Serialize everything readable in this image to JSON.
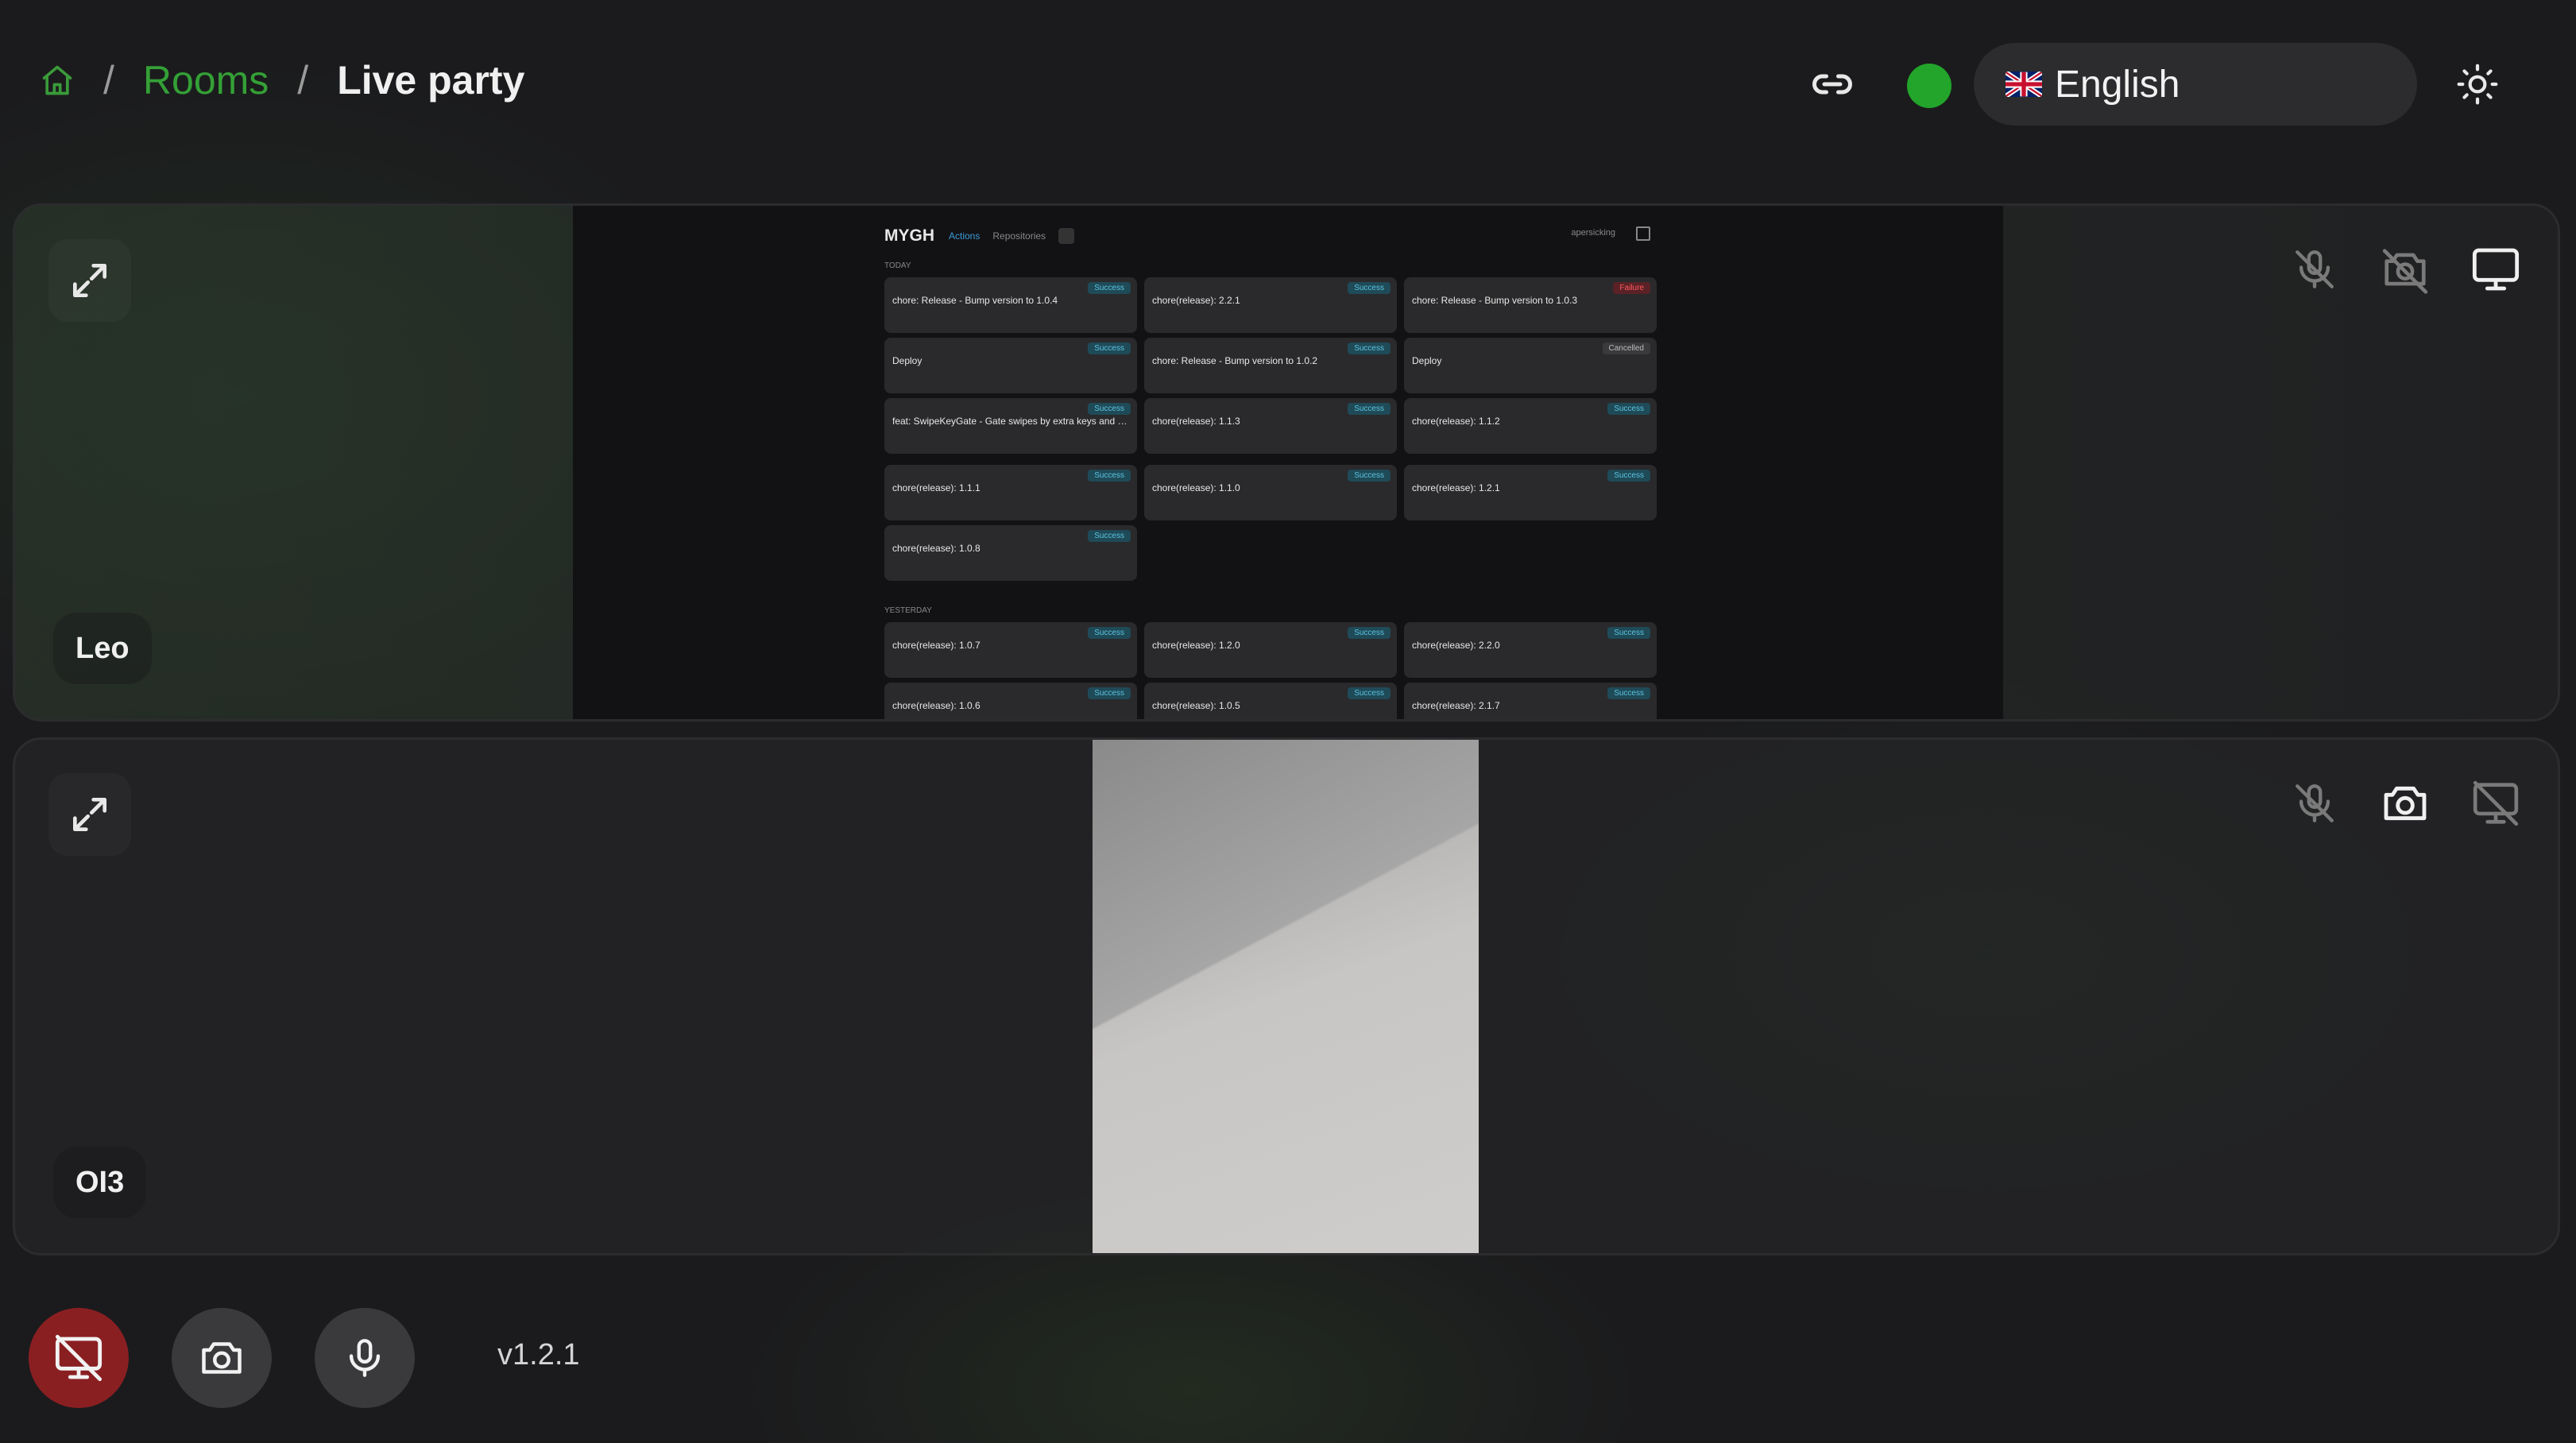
{
  "header": {
    "breadcrumb": {
      "home_icon": "home-icon",
      "separator": "/",
      "rooms": "Rooms",
      "current": "Live party"
    },
    "link_icon": "link-icon",
    "status_color": "#22a52a",
    "language": {
      "flag": "uk-flag-icon",
      "label": "English"
    },
    "theme_icon": "sun-icon"
  },
  "participants": [
    {
      "name": "Leo",
      "controls": [
        "mic-off-icon",
        "camera-off-icon",
        "screen-share-icon"
      ],
      "screen_share": {
        "app_title": "MYGH",
        "tabs": [
          "Actions",
          "Repositories"
        ],
        "user": "apersicking",
        "sections": {
          "today": "TODAY",
          "yesterday": "YESTERDAY"
        },
        "cards": [
          {
            "title": "chore: Release - Bump version to 1.0.4",
            "status": "Success"
          },
          {
            "title": "chore(release): 2.2.1",
            "status": "Success"
          },
          {
            "title": "chore: Release - Bump version to 1.0.3",
            "status": "Failure"
          },
          {
            "title": "Deploy",
            "status": "Success"
          },
          {
            "title": "chore: Release - Bump version to 1.0.2",
            "status": "Success"
          },
          {
            "title": "Deploy",
            "status": "Cancelled"
          },
          {
            "title": "feat: SwipeKeyGate - Gate swipes by extra keys and modifiers",
            "status": "Success"
          },
          {
            "title": "chore(release): 1.1.3",
            "status": "Success"
          },
          {
            "title": "chore(release): 1.1.2",
            "status": "Success"
          },
          {
            "title": "chore(release): 1.1.1",
            "status": "Success"
          },
          {
            "title": "chore(release): 1.1.0",
            "status": "Success"
          },
          {
            "title": "chore(release): 1.2.1",
            "status": "Success"
          },
          {
            "title": "chore(release): 1.0.8",
            "status": "Success"
          },
          {
            "title": "chore(release): 1.0.7",
            "status": "Success"
          },
          {
            "title": "chore(release): 1.2.0",
            "status": "Success"
          },
          {
            "title": "chore(release): 2.2.0",
            "status": "Success"
          },
          {
            "title": "chore(release): 1.0.6",
            "status": "Success"
          },
          {
            "title": "chore(release): 1.0.5",
            "status": "Success"
          },
          {
            "title": "chore(release): 2.1.7",
            "status": "Success"
          }
        ]
      }
    },
    {
      "name": "OI3",
      "controls": [
        "mic-off-icon",
        "camera-icon",
        "screen-share-off-icon"
      ]
    }
  ],
  "bottom_bar": {
    "screen_share_button": "screen-share-off-icon",
    "camera_button": "camera-icon",
    "mic_button": "mic-icon",
    "version": "v1.2.1"
  },
  "colors": {
    "accent_green": "#34a036",
    "danger_red": "#8a1f22",
    "success_badge": "#5bc4e0",
    "failure_badge": "#ff5a5f"
  }
}
